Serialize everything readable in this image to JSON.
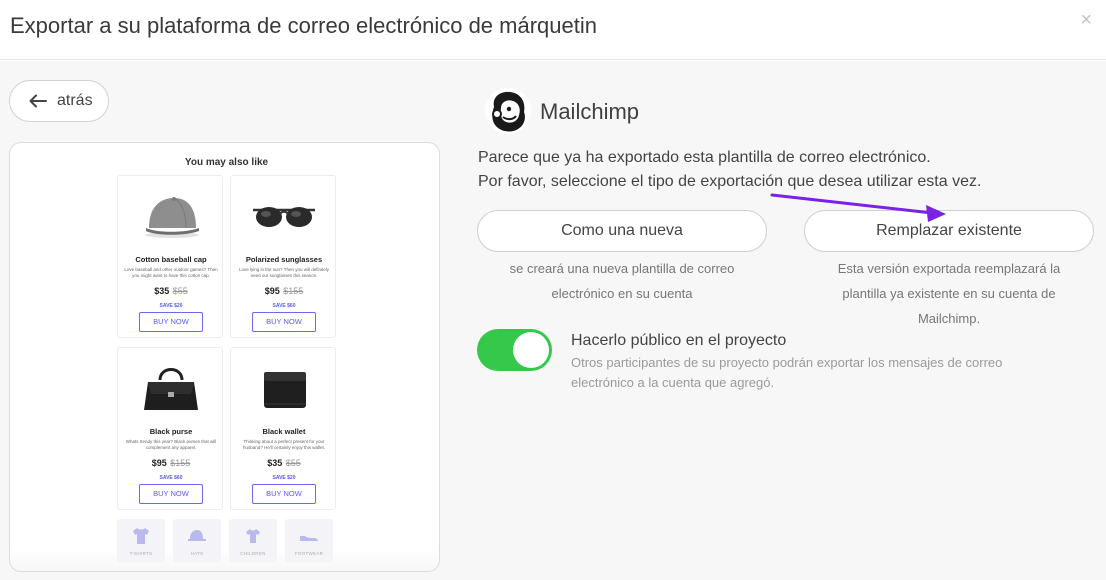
{
  "header": {
    "title": "Exportar a su plataforma de correo electrónico de márquetin",
    "close_icon": "close-icon",
    "close_glyph": "×"
  },
  "back": {
    "label": "atrás",
    "icon": "arrow-left-icon"
  },
  "preview": {
    "heading": "You may also like",
    "products": [
      {
        "name": "Cotton baseball cap",
        "desc": "Love baseball and other outdoor games? Then you might want to have this cotton cap.",
        "price": "$35",
        "old_price": "$55",
        "save": "SAVE $20",
        "cta": "BUY NOW",
        "icon": "cap-icon"
      },
      {
        "name": "Polarized sunglasses",
        "desc": "Love lying in the sun? Then you will definitely need our sunglasses this season.",
        "price": "$95",
        "old_price": "$155",
        "save": "SAVE $60",
        "cta": "BUY NOW",
        "icon": "sunglasses-icon"
      },
      {
        "name": "Black purse",
        "desc": "Whats trendy this year? Black purses that will complement any apparel.",
        "price": "$95",
        "old_price": "$155",
        "save": "SAVE $60",
        "cta": "BUY NOW",
        "icon": "purse-icon"
      },
      {
        "name": "Black wallet",
        "desc": "Thinking about a perfect present for your husband? He'll certainly enjoy this wallet.",
        "price": "$35",
        "old_price": "$55",
        "save": "SAVE $20",
        "cta": "BUY NOW",
        "icon": "wallet-icon"
      }
    ],
    "categories": [
      {
        "label": "T-SHIRTS",
        "icon": "tshirt-icon"
      },
      {
        "label": "HATS",
        "icon": "hat-icon"
      },
      {
        "label": "CHILDREN",
        "icon": "children-icon"
      },
      {
        "label": "FOOTWEAR",
        "icon": "footwear-icon"
      }
    ]
  },
  "provider": {
    "name": "Mailchimp",
    "icon": "mailchimp-logo-icon"
  },
  "intro": {
    "line1": "Parece que ya ha exportado esta plantilla de correo electrónico.",
    "line2": "Por favor, seleccione el tipo de exportación que desea utilizar esta vez."
  },
  "options": {
    "new": {
      "label": "Como una nueva",
      "desc_line1": "se creará una nueva plantilla de correo",
      "desc_line2": "electrónico en su cuenta"
    },
    "replace": {
      "label": "Remplazar existente",
      "desc_line1": "Esta versión exportada reemplazará la",
      "desc_line2": "plantilla ya existente en su cuenta de",
      "desc_line3": "Mailchimp."
    }
  },
  "public_toggle": {
    "state": "on",
    "title": "Hacerlo público en el proyecto",
    "desc_line1": "Otros participantes de su proyecto podrán exportar los mensajes de correo",
    "desc_line2": "electrónico a la cuenta que agregó."
  },
  "colors": {
    "toggle_on": "#36c84b",
    "annotation_arrow": "#7a22e6",
    "accent_link": "#5a5af0"
  }
}
